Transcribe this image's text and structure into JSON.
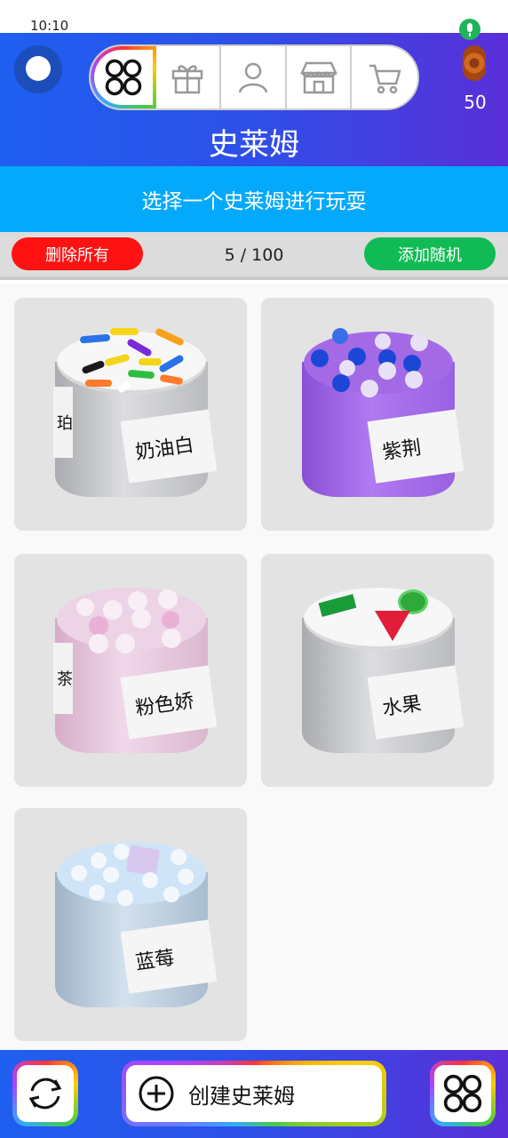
{
  "status_bar": {
    "time": "10:10"
  },
  "header": {
    "title": "史莱姆",
    "coin_count": "50",
    "tabs": [
      {
        "icon": "slime-grid-icon",
        "active": true
      },
      {
        "icon": "gift-icon",
        "active": false
      },
      {
        "icon": "user-icon",
        "active": false
      },
      {
        "icon": "shop-icon",
        "active": false
      },
      {
        "icon": "cart-icon",
        "active": false
      }
    ]
  },
  "subtitle": "选择一个史莱姆进行玩耍",
  "toolbar": {
    "delete_all": "删除所有",
    "count": "5 / 100",
    "add_random": "添加随机"
  },
  "slimes": [
    {
      "name": "奶油白",
      "side_text": "珀",
      "body_color": "#c9cbcf",
      "lid_color": "#f7f7f7"
    },
    {
      "name": "紫荆",
      "side_text": "",
      "body_color": "#9a62e0",
      "lid_color": "#a46ae6"
    },
    {
      "name": "粉色娇",
      "side_text": "茶",
      "body_color": "#e6c3dc",
      "lid_color": "#edd3e6"
    },
    {
      "name": "水果",
      "side_text": "",
      "body_color": "#c8c9cc",
      "lid_color": "#f7f7f7"
    },
    {
      "name": "蓝莓",
      "side_text": "",
      "body_color": "#b9cce0",
      "lid_color": "#cfe4f6"
    }
  ],
  "bottom_bar": {
    "create_label": "创建史莱姆"
  },
  "colors": {
    "header_blue": "#1f5ff0",
    "subtitle_blue": "#04a9fb",
    "delete_red": "#ff1212",
    "random_green": "#10bb55"
  }
}
